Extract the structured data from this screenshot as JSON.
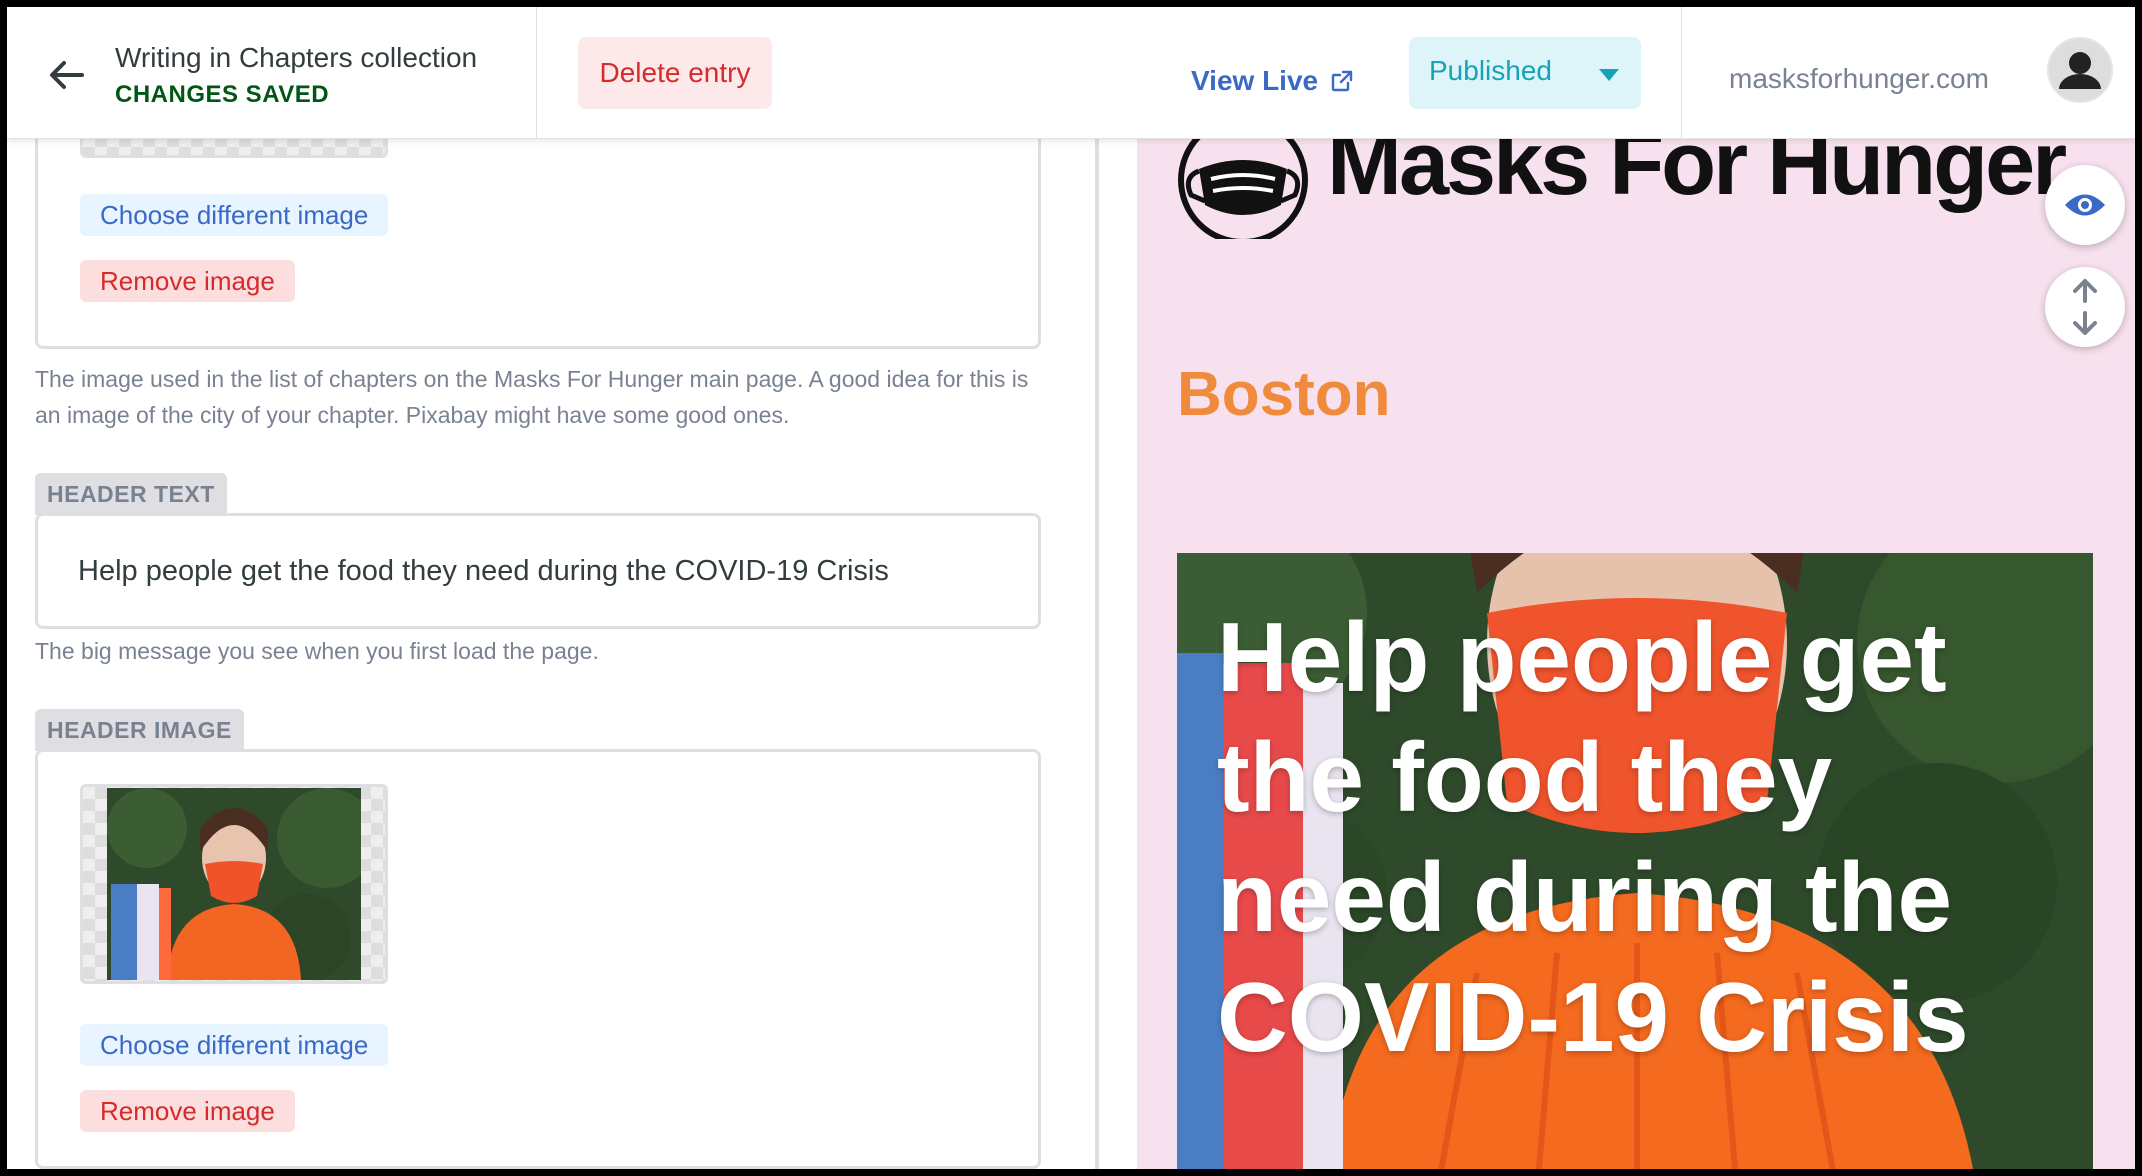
{
  "header": {
    "collection_title": "Writing in Chapters collection",
    "save_status": "CHANGES SAVED",
    "delete_label": "Delete entry",
    "view_live_label": "View Live",
    "status_label": "Published",
    "site_url": "masksforhunger.com"
  },
  "editor": {
    "image_field_top": {
      "choose_label": "Choose different image",
      "remove_label": "Remove image",
      "hint": "The image used in the list of chapters on the Masks For Hunger main page. A good idea for this is an image of the city of your chapter. Pixabay might have some good ones."
    },
    "header_text": {
      "label": "HEADER TEXT",
      "value": "Help people get the food they need during the COVID-19 Crisis",
      "hint": "The big message you see when you first load the page."
    },
    "header_image": {
      "label": "HEADER IMAGE",
      "choose_label": "Choose different image",
      "remove_label": "Remove image"
    }
  },
  "preview": {
    "brand_name": "Masks For Hunger",
    "chapter_city": "Boston",
    "hero_text": "Help people get the food they need during the COVID-19 Crisis",
    "background_color": "#f8e1ee",
    "city_color": "#f08a3c"
  },
  "colors": {
    "accent_blue": "#3a69c7",
    "danger_red": "#d52b2b",
    "success_green": "#005614",
    "published_teal": "#17a2b8"
  },
  "icons": [
    "arrow-left-icon",
    "external-link-icon",
    "chevron-down-icon",
    "user-icon",
    "eye-icon",
    "scroll-sync-icon",
    "mask-logo-icon"
  ]
}
